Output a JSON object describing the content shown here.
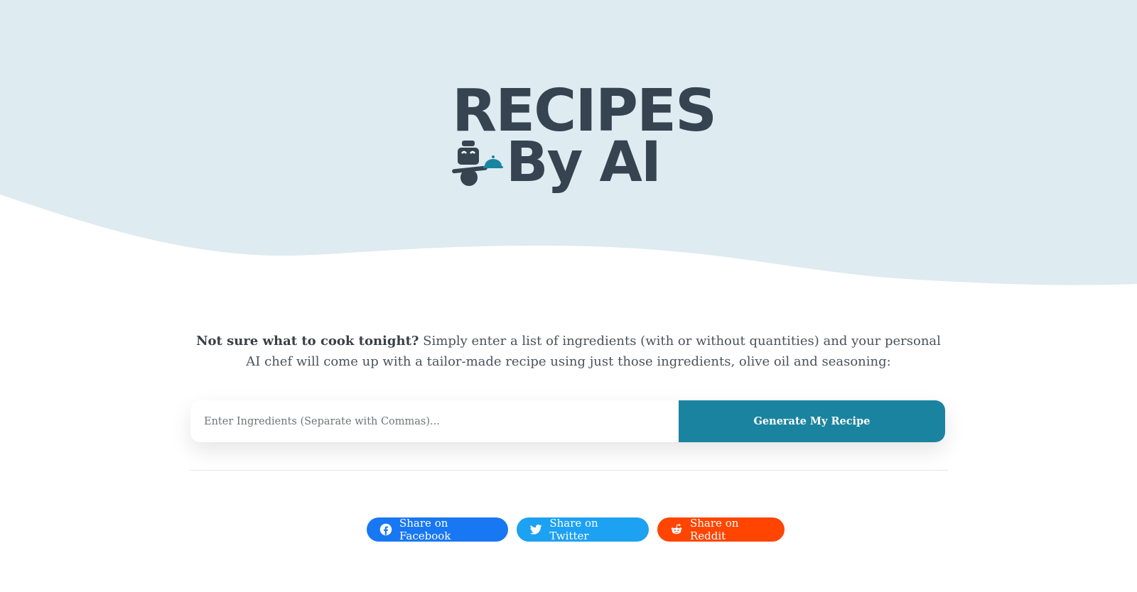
{
  "logo": {
    "line1": "RECIPES",
    "line2": "By AI"
  },
  "intro": {
    "lead": "Not sure what to cook tonight?",
    "body": " Simply enter a list of ingredients (with or without quantities) and your personal AI chef will come up with a tailor-made recipe using just those ingredients, olive oil and seasoning:"
  },
  "form": {
    "placeholder": "Enter Ingredients (Separate with Commas)...",
    "value": "",
    "submit_label": "Generate My Recipe"
  },
  "share": {
    "facebook": "Share on Facebook",
    "twitter": "Share on Twitter",
    "reddit": "Share on Reddit"
  },
  "colors": {
    "hero_bg": "#deebf1",
    "logo_text": "#364350",
    "accent": "#1a84a0",
    "facebook": "#1877f2",
    "twitter": "#1da1f2",
    "reddit": "#ff4500"
  },
  "icons": [
    "chef-robot-logo-icon",
    "facebook-icon",
    "twitter-icon",
    "reddit-icon"
  ]
}
